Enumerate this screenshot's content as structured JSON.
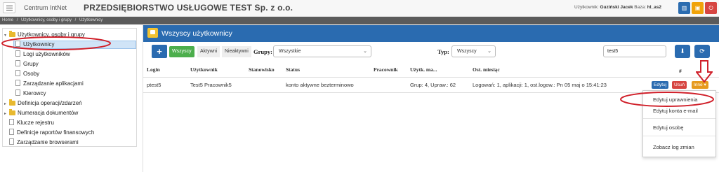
{
  "topbar": {
    "brand": "Centrum IntNet",
    "company": "PRZEDSIĘBIORSTWO USŁUGOWE TEST Sp. z o.o.",
    "user_label": "Użytkownik:",
    "user_name": "Guziński Jacek",
    "db_label": "Baza:",
    "db_name": "hl_as2"
  },
  "breadcrumb": [
    "Home",
    "/",
    "Użytkownicy, osoby i grupy",
    "/",
    "Użytkownicy"
  ],
  "tree": {
    "root": "Użytkownicy, osoby i grupy",
    "children": [
      "Użytkownicy",
      "Logi użytkowników",
      "Grupy",
      "Osoby",
      "Zarządzanie aplikacjami",
      "Kierowcy"
    ],
    "other": [
      "Definicja operacji/zdarzeń",
      "Numeracja dokumentów",
      "Klucze rejestru",
      "Definicje raportów finansowych",
      "Zarządzanie browserami"
    ]
  },
  "panel": {
    "title": "Wszyscy użytkownicy",
    "add": "+",
    "filters": {
      "all": "Wszyscy",
      "active": "Aktywni",
      "inactive": "Nieaktywni"
    },
    "group_label": "Grupy:",
    "group_value": "Wszystkie",
    "type_label": "Typ:",
    "type_value": "Wszyscy",
    "search_value": "test5"
  },
  "table": {
    "headers": [
      "Login",
      "Użytkownik",
      "Stanowisko",
      "Status",
      "Pracownik",
      "Użytk. ma...",
      "Ost. miesiąc",
      "#"
    ],
    "rows": [
      {
        "login": "ptest5",
        "user": "Test5 Pracownik5",
        "position": "",
        "status": "konto aktywne bezterminowo",
        "employee": "",
        "has": "Grup: 4, Upraw.: 62",
        "last_month": "Logowań: 1, aplikacji: 1, ost.logow.: Pn 05 maj o 15:41:23"
      }
    ],
    "actions": {
      "edit": "Edytuj",
      "delete": "Usuń",
      "more": "Inne ▾"
    }
  },
  "menu": [
    "Edytuj uprawnienia",
    "Edytuj konta e-mail",
    "Edytuj osobę",
    "Zobacz log zmian"
  ],
  "colors": {
    "header": "#2a6bb0",
    "accent_green": "#4cae4c",
    "annotation": "#d0202a"
  }
}
